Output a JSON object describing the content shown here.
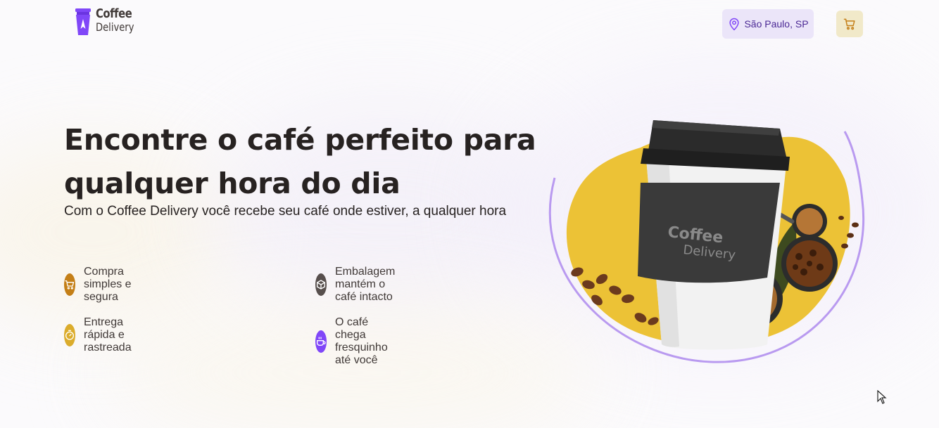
{
  "brand": {
    "line1": "Coffee",
    "line2": "Delivery"
  },
  "header": {
    "location": "São Paulo, SP",
    "location_icon": "map-pin-icon",
    "cart_icon": "shopping-cart-icon"
  },
  "hero": {
    "title_line1": "Encontre o café perfeito para",
    "title_line2": "qualquer hora do dia",
    "subtitle": "Com o Coffee Delivery você recebe seu café onde estiver, a qualquer hora",
    "features": [
      {
        "label": "Compra simples e segura",
        "icon": "shopping-cart-icon",
        "color": "#c47f17"
      },
      {
        "label": "Embalagem mantém o café intacto",
        "icon": "package-icon",
        "color": "#574f4d"
      },
      {
        "label": "Entrega rápida e rastreada",
        "icon": "timer-icon",
        "color": "#dbac2c"
      },
      {
        "label": "O café chega fresquinho até você",
        "icon": "coffee-icon",
        "color": "#8047f8"
      }
    ],
    "cup_logo_line1": "Coffee",
    "cup_logo_line2": "Delivery"
  },
  "colors": {
    "purple": "#8047f8",
    "purple_light": "#ebe5f9",
    "yellow": "#dbac2c",
    "yellow_light": "#f1e9c9",
    "yellow_dark": "#c47f17",
    "base_text": "#403937"
  }
}
